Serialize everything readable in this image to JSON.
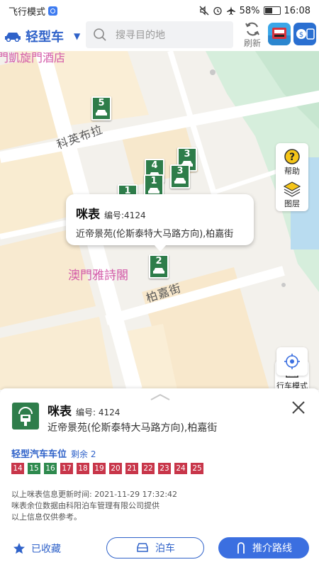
{
  "status_bar": {
    "mode_label": "飞行模式",
    "battery_text": "58%",
    "battery_level": 0.58,
    "time": "16:08"
  },
  "top_bar": {
    "vehicle_type": "轻型车",
    "search_placeholder": "搜寻目的地",
    "refresh_label": "刷新"
  },
  "map": {
    "hotel_label_top": "門凱旋門酒店",
    "hotel_label": "澳門雅詩閣",
    "street_1": "科英布拉",
    "street_2": "柏嘉街",
    "pins": [
      "5",
      "3",
      "4",
      "3",
      "1",
      "1",
      "2"
    ],
    "tools": {
      "help_label": "帮助",
      "layers_label": "图层",
      "drive_mode_label": "行车模式"
    }
  },
  "callout": {
    "title": "咪表",
    "code": "编号:4124",
    "address": "近帝景苑(伦斯泰特大马路方向),柏嘉街"
  },
  "sheet": {
    "title": "咪表",
    "code": "编号: 4124",
    "address": "近帝景苑(伦斯泰特大马路方向),柏嘉街",
    "section_label": "轻型汽车车位",
    "remaining": "剩余 2",
    "spaces": [
      {
        "n": "14",
        "status": "occupied"
      },
      {
        "n": "15",
        "status": "free"
      },
      {
        "n": "16",
        "status": "free"
      },
      {
        "n": "17",
        "status": "occupied"
      },
      {
        "n": "18",
        "status": "occupied"
      },
      {
        "n": "19",
        "status": "occupied"
      },
      {
        "n": "20",
        "status": "occupied"
      },
      {
        "n": "21",
        "status": "occupied"
      },
      {
        "n": "22",
        "status": "occupied"
      },
      {
        "n": "23",
        "status": "occupied"
      },
      {
        "n": "24",
        "status": "occupied"
      },
      {
        "n": "25",
        "status": "occupied"
      }
    ],
    "colors": {
      "occupied": "#c8364a",
      "free": "#2e8a4e"
    },
    "info": [
      "以上咪表信息更新时间:   2021-11-29 17:32:42",
      "咪表余位数据由科阳泊车管理有限公司提供",
      "以上信息仅供参考。"
    ],
    "favorite_label": "已收藏",
    "park_label": "泊车",
    "route_label": "推介路线"
  }
}
